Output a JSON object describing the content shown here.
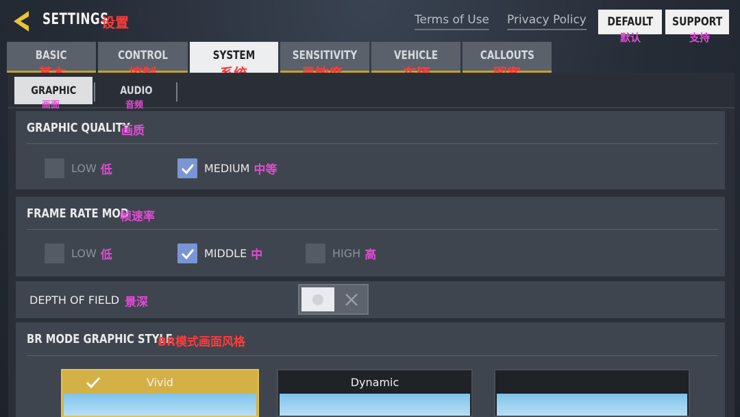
{
  "header": {
    "title": "SETTINGS",
    "title_cn": "设置",
    "links": [
      "Terms of Use",
      "Privacy Policy"
    ],
    "buttons": [
      {
        "label": "DEFAULT",
        "cn": "默认"
      },
      {
        "label": "SUPPORT",
        "cn": "支持"
      }
    ]
  },
  "tabs": [
    {
      "label": "BASIC",
      "cn": "基本"
    },
    {
      "label": "CONTROL",
      "cn": "控制"
    },
    {
      "label": "SYSTEM",
      "cn": "系统"
    },
    {
      "label": "SENSITIVITY",
      "cn": "灵敏度"
    },
    {
      "label": "VEHICLE",
      "cn": "车辆"
    },
    {
      "label": "CALLOUTS",
      "cn": "图案"
    }
  ],
  "subtabs": [
    {
      "label": "GRAPHIC",
      "cn": "画面"
    },
    {
      "label": "AUDIO",
      "cn": "音频"
    }
  ],
  "graphic_quality": {
    "title": "GRAPHIC QUALITY",
    "title_cn": "画质",
    "options": [
      {
        "label": "LOW",
        "cn": "低",
        "checked": false
      },
      {
        "label": "MEDIUM",
        "cn": "中等",
        "checked": true
      }
    ]
  },
  "frame_rate": {
    "title": "FRAME RATE MOD",
    "title_cn": "帧速率",
    "options": [
      {
        "label": "LOW",
        "cn": "低",
        "checked": false
      },
      {
        "label": "MIDDLE",
        "cn": "中",
        "checked": true
      },
      {
        "label": "HIGH",
        "cn": "高",
        "checked": false
      }
    ]
  },
  "depth_of_field": {
    "label": "DEPTH OF FIELD",
    "cn": "景深",
    "enabled": false
  },
  "br_style": {
    "title": "BR MODE GRAPHIC STYLE",
    "title_cn": "BR模式画面风格",
    "options": [
      {
        "label": "Vivid",
        "selected": true
      },
      {
        "label": "Dynamic",
        "selected": false
      },
      {
        "label": "",
        "selected": false
      }
    ]
  },
  "colors": {
    "accent_gold": "#c9a227",
    "checkbox_checked": "#7a95d4",
    "annotation_magenta": "#e04bd4",
    "annotation_red": "#ff3b3b"
  }
}
